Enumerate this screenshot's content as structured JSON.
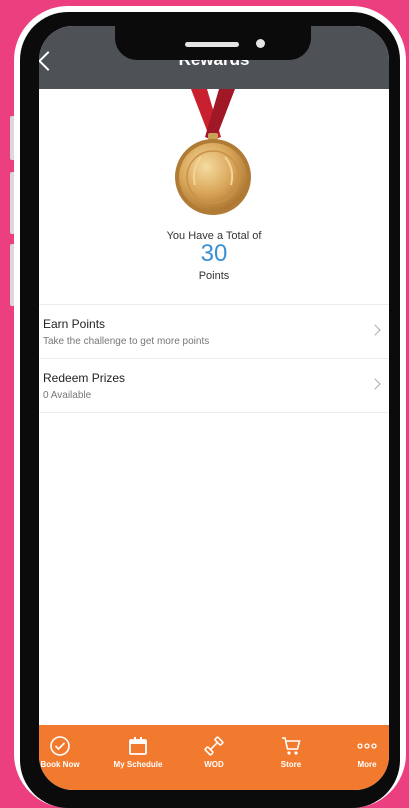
{
  "header": {
    "title": "Rewards"
  },
  "points": {
    "caption": "You Have a Total of",
    "value": "30",
    "unit": "Points"
  },
  "menu": [
    {
      "title": "Earn Points",
      "subtitle": "Take the challenge to get more points"
    },
    {
      "title": "Redeem Prizes",
      "subtitle": "0 Available"
    }
  ],
  "tabs": [
    {
      "label": "Book Now",
      "icon": "check-circle-icon"
    },
    {
      "label": "My Schedule",
      "icon": "calendar-icon"
    },
    {
      "label": "WOD",
      "icon": "dumbbell-icon"
    },
    {
      "label": "Store",
      "icon": "cart-icon"
    },
    {
      "label": "More",
      "icon": "more-dots-icon"
    }
  ],
  "colors": {
    "background": "#ec3f7f",
    "header": "#4e5257",
    "accent": "#f27a2f",
    "points": "#3c8fd1",
    "ribbon": "#c8202f",
    "medal": "#d9a65a"
  }
}
